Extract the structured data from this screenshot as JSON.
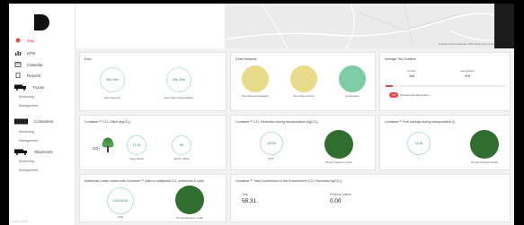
{
  "sidebar": {
    "items": [
      {
        "label": "Map",
        "icon": "pin-icon",
        "active": true
      },
      {
        "label": "KPIs",
        "icon": "chart-icon"
      },
      {
        "label": "Calendar",
        "icon": "calendar-icon"
      },
      {
        "label": "Reports",
        "icon": "report-icon"
      },
      {
        "label": "Trucks",
        "icon": "truck-icon"
      },
      {
        "label": "Containers",
        "icon": "container-icon"
      },
      {
        "label": "Shipments",
        "icon": "shipment-icon"
      }
    ],
    "trucks_subs": [
      "Monitoring",
      "Management"
    ],
    "containers_subs": [
      "Monitoring",
      "Management"
    ],
    "shipments_subs": [
      "Monitoring",
      "Management"
    ]
  },
  "map": {
    "footer": "Keyboard shortcuts   Map data ©2022 Google   Terms of Use"
  },
  "doors": {
    "title": "Door",
    "open_time": "00h 00m",
    "open_time_label": "Door Open On",
    "transport": "00h 26m",
    "transport_label": "Door Open Transportation"
  },
  "exam": {
    "title": "Exam Analysis",
    "items": [
      "Door Opened Unloaded",
      "Door Open Onsite",
      "Temperature"
    ]
  },
  "avg": {
    "title": "Average Trip Duration",
    "current_label": "Current",
    "current_val": "26d",
    "last_label": "Last Quarter",
    "last_val": "29d",
    "badge": "7%",
    "badge_text": "Fill lower than last Quarter"
  },
  "co2_offset": {
    "title": "Container™ CO₂ Offset (kgCO₂)",
    "co2": "CO₂",
    "trees_val": "11.26",
    "trees_label": "Trees Saved",
    "kg_val": "56",
    "kg_label": "kgCO₂ Offset"
  },
  "co2_reduction": {
    "title": "Container™ CO₂ Reduction during transportation (kgCO₂)",
    "val": "18726",
    "val_label": "NOT₂",
    "model_label": "Pit and Transport model"
  },
  "fuel": {
    "title": "Container™ Fuel savings during transportation (l)",
    "val": "11.46",
    "val_label": "l",
    "model_label": "Pit and Transport model"
  },
  "loads": {
    "title": "Additional Loads moved with Container™ (with no additional CO₂ emissions & cost)",
    "val": "134146.60",
    "val_label": "Units",
    "model_label": "Pit and Transport model"
  },
  "total": {
    "title": "Container™ Total Contribution to the Environment (CO₂ Reduction kgCO₂)",
    "total_label": "Total",
    "total_val": "58.31",
    "prev_label": "Previous Quarter",
    "prev_val": "0.00"
  },
  "footer_note": "version 1.25.6",
  "colors": {
    "accent": "#e84a4a",
    "green": "#2f6e2f",
    "yellow": "#e8dc8a",
    "teal": "#7ccfa5"
  }
}
